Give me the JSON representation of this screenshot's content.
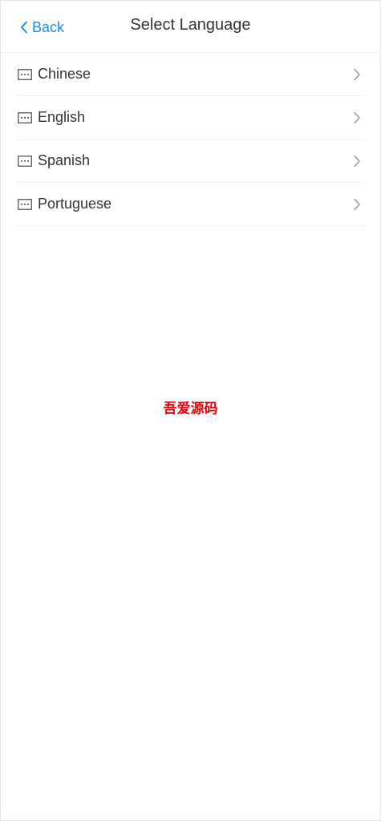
{
  "header": {
    "back_label": "Back",
    "title": "Select Language"
  },
  "languages": [
    {
      "label": "Chinese",
      "icon": "keyboard-icon"
    },
    {
      "label": "English",
      "icon": "keyboard-icon"
    },
    {
      "label": "Spanish",
      "icon": "keyboard-icon"
    },
    {
      "label": "Portuguese",
      "icon": "keyboard-icon"
    }
  ],
  "watermark": {
    "text": "吾爱源码"
  },
  "colors": {
    "accent": "#1d8cf0",
    "watermark": "#e8000a"
  }
}
